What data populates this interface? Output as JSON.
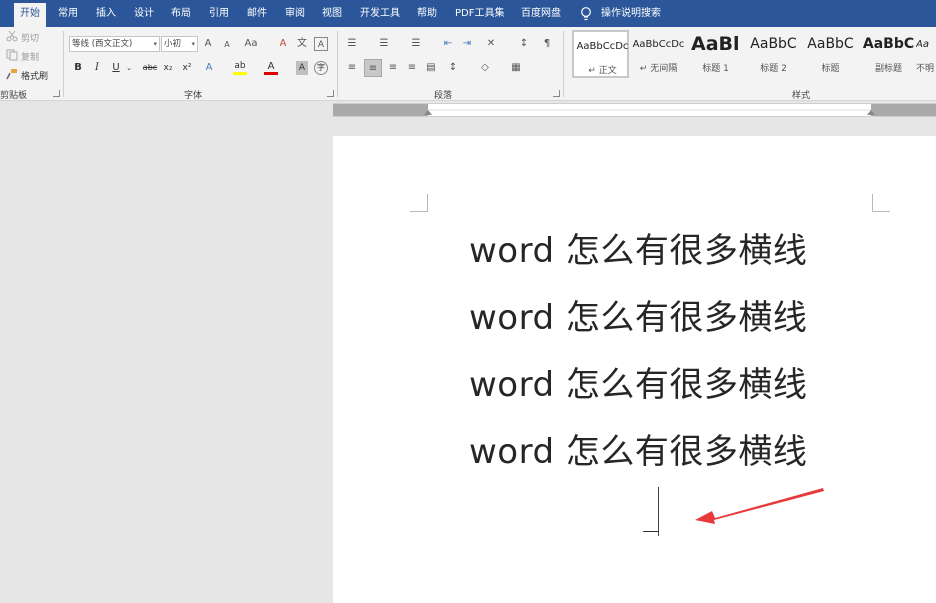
{
  "tabs": [
    {
      "label": "开始",
      "active": true
    },
    {
      "label": "常用"
    },
    {
      "label": "插入"
    },
    {
      "label": "设计"
    },
    {
      "label": "布局"
    },
    {
      "label": "引用"
    },
    {
      "label": "邮件"
    },
    {
      "label": "审阅"
    },
    {
      "label": "视图"
    },
    {
      "label": "开发工具"
    },
    {
      "label": "帮助"
    },
    {
      "label": "PDF工具集"
    },
    {
      "label": "百度网盘"
    },
    {
      "label": "操作说明搜索"
    }
  ],
  "clipboard": {
    "cut": "剪切",
    "copy": "复制",
    "format_painter": "格式刷",
    "group_label": "剪贴板"
  },
  "font": {
    "name": "等线 (西文正文)",
    "size": "小初",
    "grow": "A",
    "shrink": "A",
    "change_case": "Aa",
    "bold": "B",
    "italic": "I",
    "underline": "U",
    "strike": "abc",
    "subscript": "x₂",
    "superscript": "x²",
    "effects": "A",
    "highlight": "ab",
    "color": "A",
    "shading": "A",
    "enclose": "字",
    "group_label": "字体"
  },
  "paragraph": {
    "group_label": "段落"
  },
  "styles": {
    "items": [
      {
        "preview": "AaBbCcDc",
        "name": "↵ 正文"
      },
      {
        "preview": "AaBbCcDc",
        "name": "↵ 无间隔"
      },
      {
        "preview": "AaBl",
        "name": "标题 1"
      },
      {
        "preview": "AaBbC",
        "name": "标题 2"
      },
      {
        "preview": "AaBbC",
        "name": "标题"
      },
      {
        "preview": "AaBbC",
        "name": "副标题"
      },
      {
        "preview": "Aa",
        "name": "不明"
      }
    ],
    "group_label": "样式"
  },
  "document": {
    "lines": [
      "word 怎么有很多横线",
      "word 怎么有很多横线",
      "word 怎么有很多横线",
      "word 怎么有很多横线"
    ]
  },
  "colors": {
    "accent": "#2b579a",
    "arrow": "#e83a3a",
    "highlight": "#ffff00",
    "font_color": "#e00000"
  },
  "icons": [
    "cut-icon",
    "copy-icon",
    "format-painter-icon",
    "lightbulb-icon",
    "annotation-arrow-icon"
  ]
}
